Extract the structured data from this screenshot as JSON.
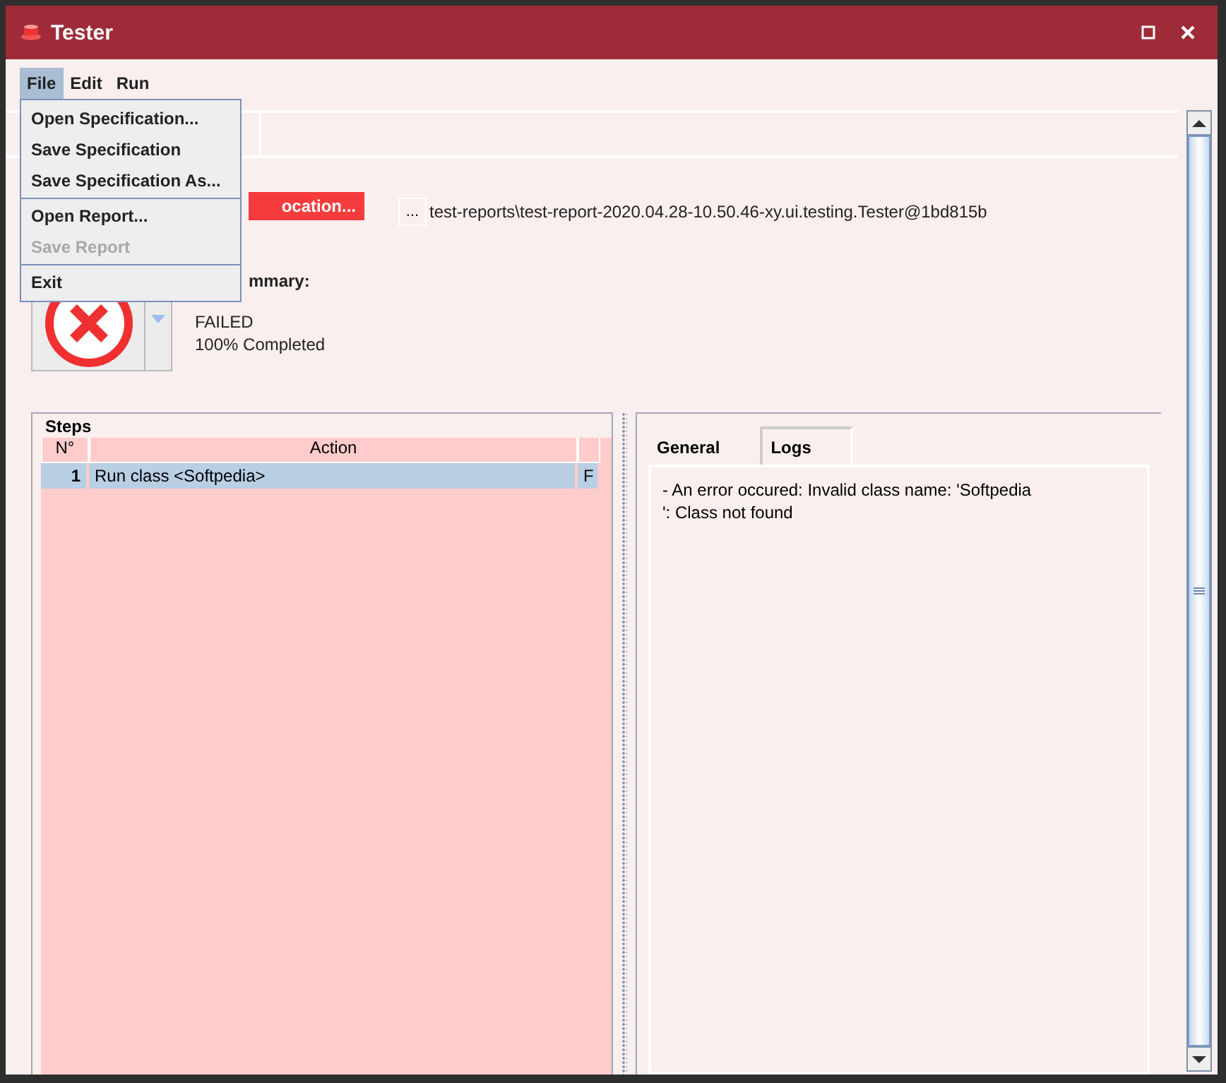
{
  "window": {
    "title": "Tester"
  },
  "menu_bar": [
    {
      "label": "File",
      "selected": true
    },
    {
      "label": "Edit",
      "selected": false
    },
    {
      "label": "Run",
      "selected": false
    }
  ],
  "file_menu": [
    {
      "kind": "item",
      "label": "Open Specification...",
      "disabled": false
    },
    {
      "kind": "item",
      "label": "Save Specification",
      "disabled": false
    },
    {
      "kind": "item",
      "label": "Save Specification As...",
      "disabled": false
    },
    {
      "kind": "separator"
    },
    {
      "kind": "item",
      "label": "Open Report...",
      "disabled": false
    },
    {
      "kind": "item",
      "label": "Save Report",
      "disabled": true
    },
    {
      "kind": "separator"
    },
    {
      "kind": "item",
      "label": "Exit",
      "disabled": false
    }
  ],
  "report": {
    "location_button": "ocation...",
    "browse_button": "...",
    "path": "test-reports\\test-report-2020.04.28-10.50.46-xy.ui.testing.Tester@1bd815b",
    "summary_label": "mmary:",
    "failed": true,
    "result": "FAILED",
    "progress": "100% Completed"
  },
  "steps": {
    "title": "Steps",
    "columns": [
      "N°",
      "Action",
      ""
    ],
    "rows": [
      {
        "selected": true,
        "cells": [
          "1",
          "Run class <Softpedia>",
          "F"
        ]
      }
    ]
  },
  "details": {
    "tabs": [
      {
        "label": "General",
        "selected": false
      },
      {
        "label": "Logs",
        "selected": true
      }
    ],
    "log_lines": [
      "- An error occured: Invalid class name: 'Softpedia",
      "': Class not found"
    ]
  }
}
